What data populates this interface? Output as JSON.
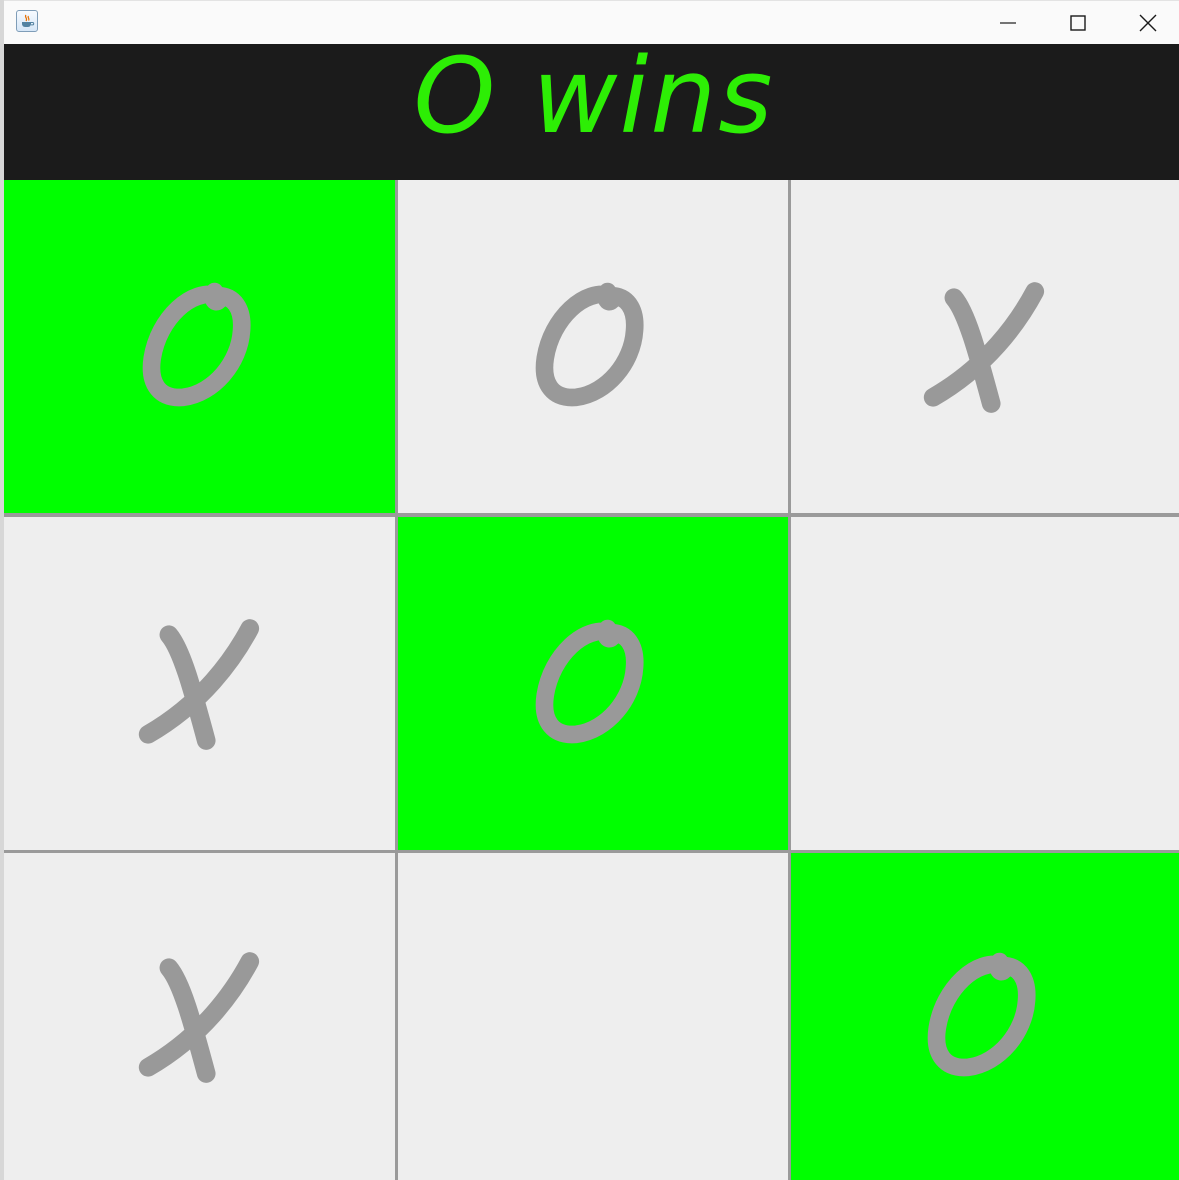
{
  "window": {
    "title": "",
    "controls": [
      "minimize",
      "maximize",
      "close"
    ]
  },
  "status": {
    "text": "O wins",
    "color": "#2dee05"
  },
  "board": {
    "win_color": "#00ff00",
    "mark_color": "#999999",
    "cells": [
      {
        "mark": "O",
        "winning": true
      },
      {
        "mark": "O",
        "winning": false
      },
      {
        "mark": "X",
        "winning": false
      },
      {
        "mark": "X",
        "winning": false
      },
      {
        "mark": "O",
        "winning": true
      },
      {
        "mark": "",
        "winning": false
      },
      {
        "mark": "X",
        "winning": false
      },
      {
        "mark": "",
        "winning": false
      },
      {
        "mark": "O",
        "winning": true
      }
    ]
  }
}
